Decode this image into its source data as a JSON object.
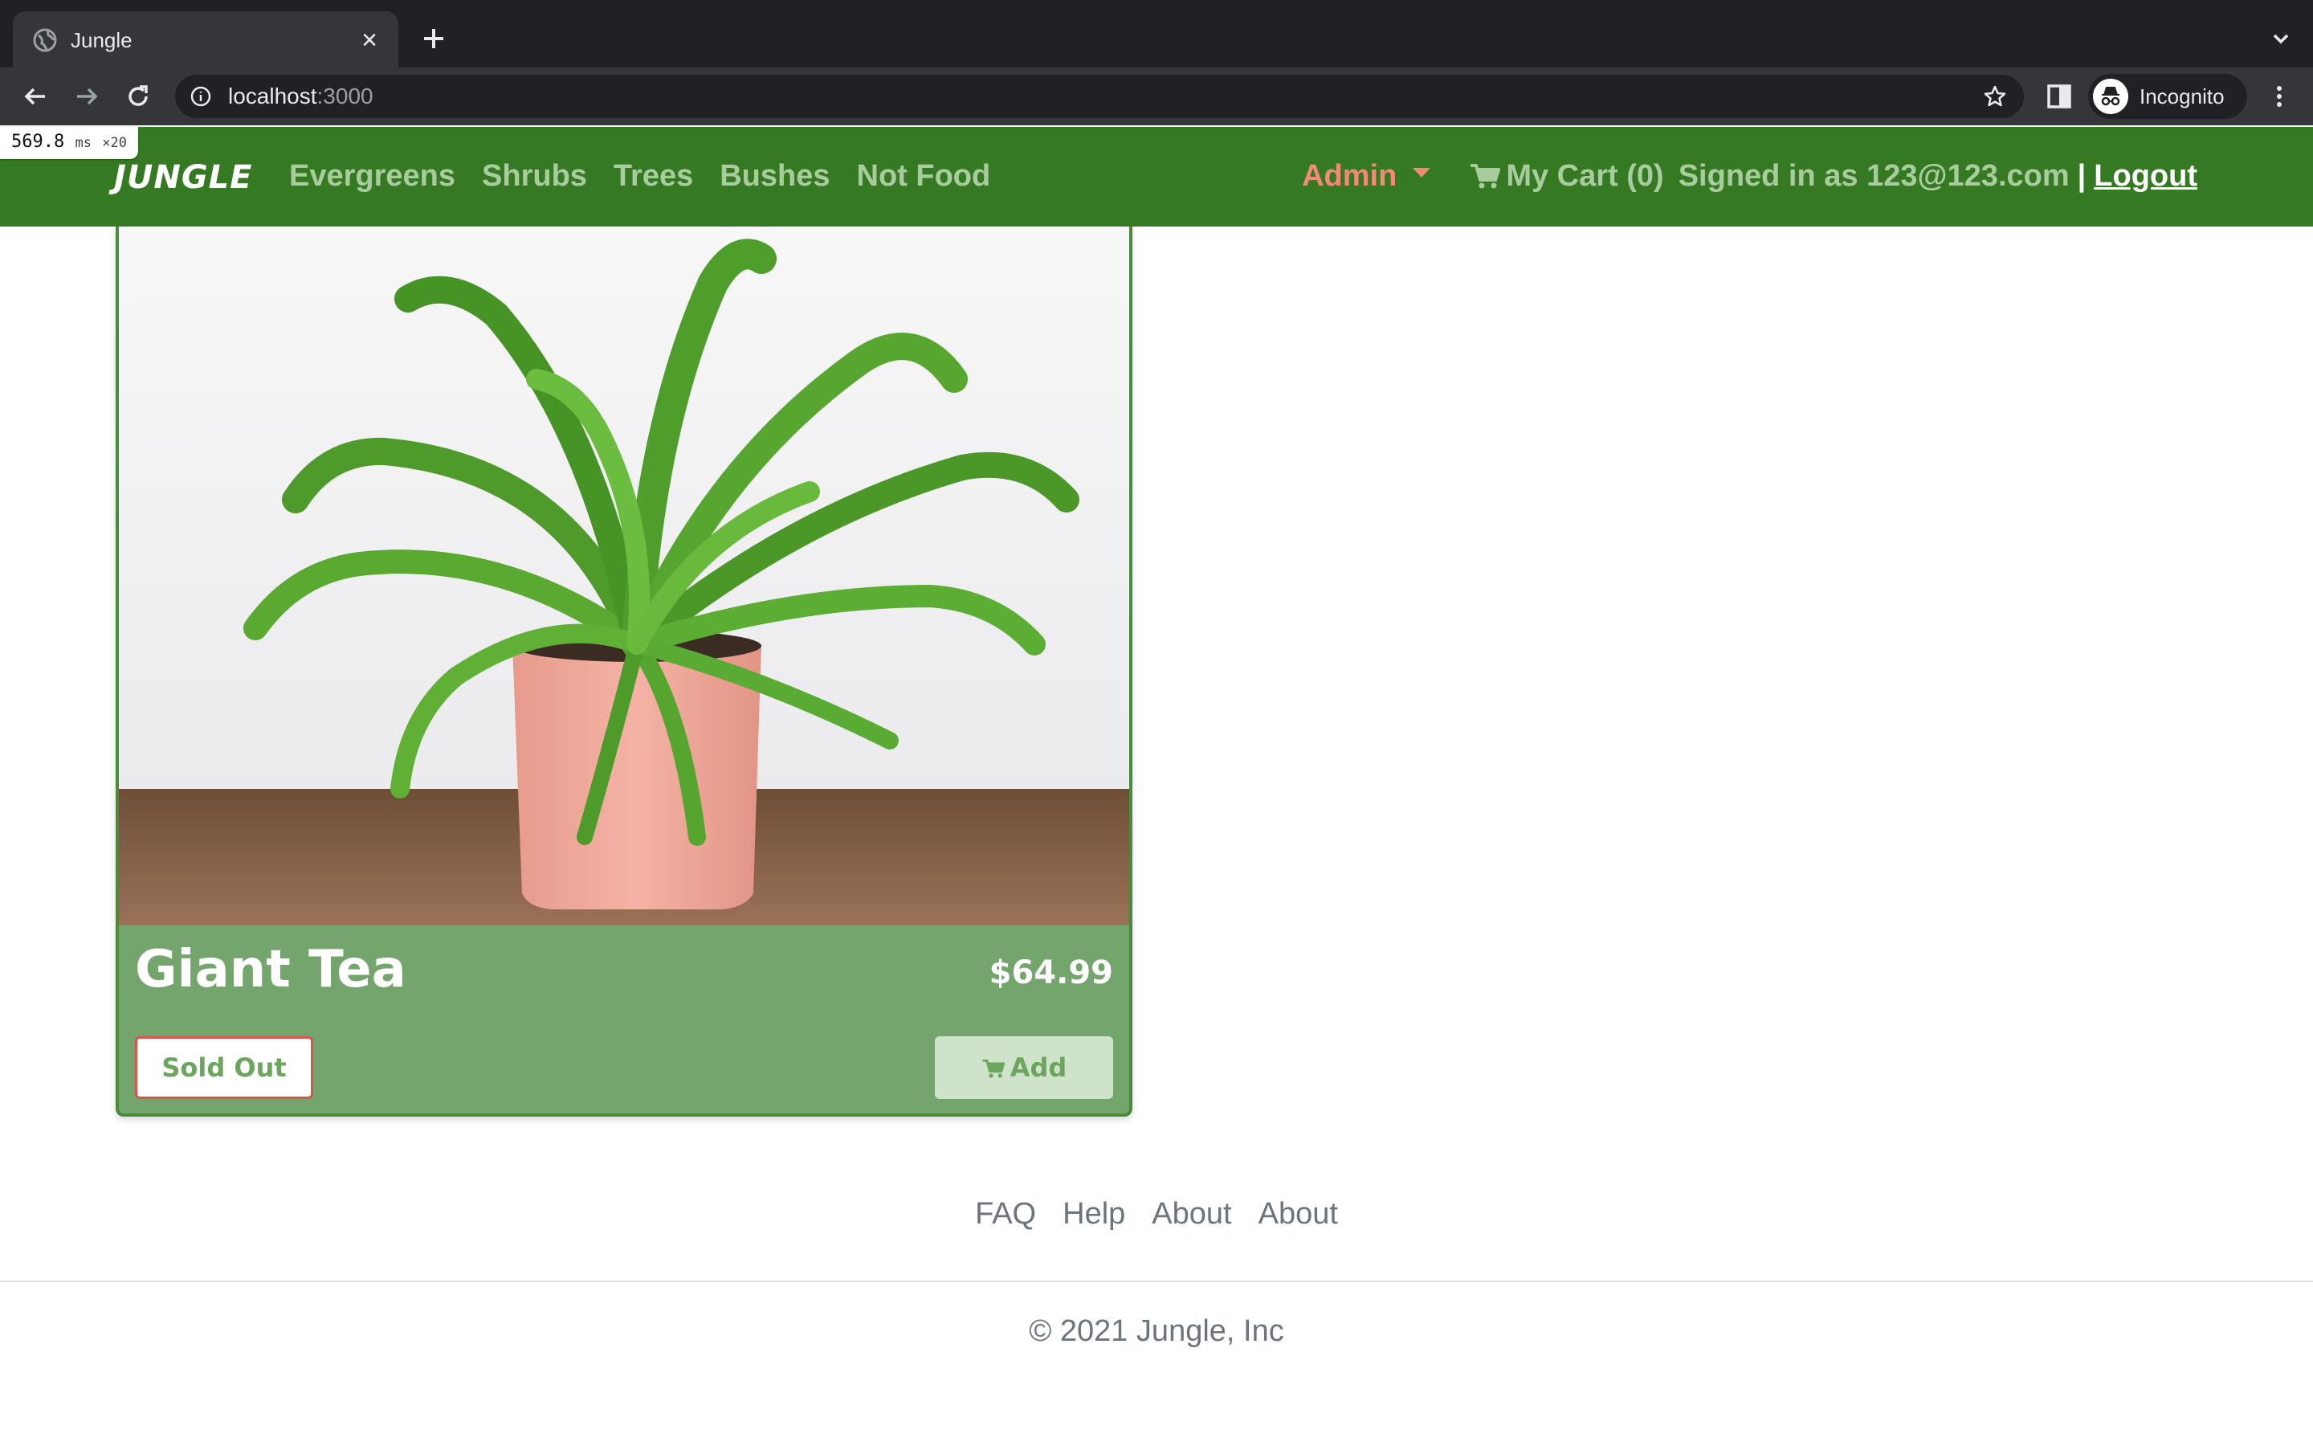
{
  "browser": {
    "tab_title": "Jungle",
    "url_host": "localhost",
    "url_port": ":3000",
    "profile_label": "Incognito",
    "perf_value": "569.8",
    "perf_unit": "ms",
    "perf_count": "×20"
  },
  "nav": {
    "brand": "JUNGLE",
    "links": [
      "Evergreens",
      "Shrubs",
      "Trees",
      "Bushes",
      "Not Food"
    ],
    "admin": "Admin",
    "cart": "My Cart (0)",
    "signed_in": "Signed in as 123@123.com",
    "separator": "|",
    "logout": "Logout"
  },
  "product": {
    "name": "Giant Tea",
    "price": "$64.99",
    "sold_out_label": "Sold Out",
    "add_label": "Add"
  },
  "footer": {
    "links": [
      "FAQ",
      "Help",
      "About",
      "About"
    ],
    "copyright": "© 2021 Jungle, Inc"
  },
  "colors": {
    "nav_bg": "#357a23",
    "nav_link": "#a9cc9f",
    "admin": "#f08a76",
    "card_bg": "#74a56c",
    "sold_out_border": "#d9534f"
  },
  "icons": [
    "globe-icon",
    "close-icon",
    "plus-icon",
    "chevron-down-icon",
    "back-arrow-icon",
    "forward-arrow-icon",
    "reload-icon",
    "info-icon",
    "star-icon",
    "side-panel-icon",
    "incognito-icon",
    "more-vert-icon",
    "caret-down-icon",
    "cart-icon"
  ]
}
